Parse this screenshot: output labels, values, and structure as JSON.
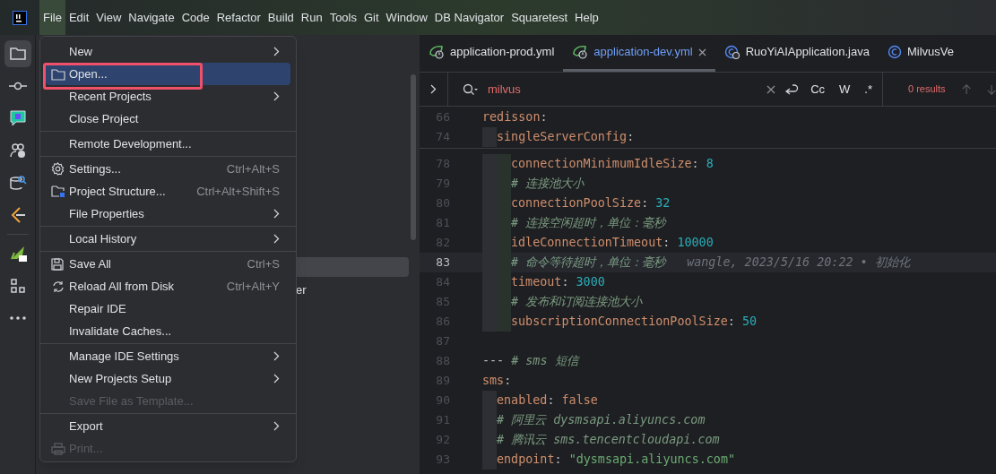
{
  "menubar": {
    "items": [
      {
        "label": "File",
        "selected": true
      },
      {
        "label": "Edit",
        "selected": false
      },
      {
        "label": "View",
        "selected": false
      },
      {
        "label": "Navigate",
        "selected": false
      },
      {
        "label": "Code",
        "selected": false
      },
      {
        "label": "Refactor",
        "selected": false
      },
      {
        "label": "Build",
        "selected": false
      },
      {
        "label": "Run",
        "selected": false
      },
      {
        "label": "Tools",
        "selected": false
      },
      {
        "label": "Git",
        "selected": false
      },
      {
        "label": "Window",
        "selected": false
      },
      {
        "label": "DB Navigator",
        "selected": false
      },
      {
        "label": "Squaretest",
        "selected": false
      },
      {
        "label": "Help",
        "selected": false
      }
    ]
  },
  "toolbar": {
    "items": [
      {
        "kind": "folder",
        "selected": true
      },
      {
        "kind": "commit",
        "selected": false
      },
      {
        "kind": "chat",
        "selected": false
      },
      {
        "kind": "people",
        "selected": false
      },
      {
        "kind": "database",
        "selected": false
      },
      {
        "kind": "code",
        "selected": false
      },
      {
        "kind": "rocket",
        "selected": false
      },
      {
        "kind": "grid",
        "selected": false
      },
      {
        "kind": "more",
        "selected": false
      }
    ]
  },
  "project_panel": {
    "row_text": "er"
  },
  "file_menu": {
    "sections": [
      {
        "items": [
          {
            "label": "New",
            "kind": "plain",
            "submenu": true,
            "selected": false,
            "disabled": false
          },
          {
            "label": "Open...",
            "kind": "folder",
            "submenu": false,
            "selected": true,
            "disabled": false
          },
          {
            "label": "Recent Projects",
            "kind": "plain",
            "submenu": true,
            "selected": false,
            "disabled": false
          },
          {
            "label": "Close Project",
            "kind": "plain",
            "submenu": false,
            "selected": false,
            "disabled": false
          }
        ]
      },
      {
        "items": [
          {
            "label": "Remote Development...",
            "kind": "plain",
            "submenu": false,
            "selected": false,
            "disabled": false
          }
        ]
      },
      {
        "items": [
          {
            "label": "Settings...",
            "kind": "gear",
            "shortcut": "Ctrl+Alt+S",
            "submenu": false,
            "selected": false,
            "disabled": false
          },
          {
            "label": "Project Structure...",
            "kind": "structure",
            "shortcut": "Ctrl+Alt+Shift+S",
            "submenu": false,
            "selected": false,
            "disabled": false
          },
          {
            "label": "File Properties",
            "kind": "plain",
            "submenu": true,
            "selected": false,
            "disabled": false
          }
        ]
      },
      {
        "items": [
          {
            "label": "Local History",
            "kind": "plain",
            "submenu": true,
            "selected": false,
            "disabled": false
          }
        ]
      },
      {
        "items": [
          {
            "label": "Save All",
            "kind": "save",
            "shortcut": "Ctrl+S",
            "submenu": false,
            "selected": false,
            "disabled": false
          },
          {
            "label": "Reload All from Disk",
            "kind": "reload",
            "shortcut": "Ctrl+Alt+Y",
            "submenu": false,
            "selected": false,
            "disabled": false
          },
          {
            "label": "Repair IDE",
            "kind": "plain",
            "submenu": false,
            "selected": false,
            "disabled": false
          },
          {
            "label": "Invalidate Caches...",
            "kind": "plain",
            "submenu": false,
            "selected": false,
            "disabled": false
          }
        ]
      },
      {
        "items": [
          {
            "label": "Manage IDE Settings",
            "kind": "plain",
            "submenu": true,
            "selected": false,
            "disabled": false
          },
          {
            "label": "New Projects Setup",
            "kind": "plain",
            "submenu": true,
            "selected": false,
            "disabled": false
          },
          {
            "label": "Save File as Template...",
            "kind": "plain",
            "submenu": false,
            "selected": false,
            "disabled": true
          }
        ]
      },
      {
        "items": [
          {
            "label": "Export",
            "kind": "plain",
            "submenu": true,
            "selected": false,
            "disabled": false
          },
          {
            "label": "Print...",
            "kind": "print",
            "submenu": false,
            "selected": false,
            "disabled": true
          }
        ]
      }
    ]
  },
  "editor_tabs": [
    {
      "label": "application-prod.yml",
      "kind": "yaml",
      "selected": false
    },
    {
      "label": "application-dev.yml",
      "kind": "yaml",
      "selected": true
    },
    {
      "label": "RuoYiAIApplication.java",
      "kind": "app",
      "selected": false
    },
    {
      "label": "MilvusVe",
      "kind": "class",
      "selected": false
    }
  ],
  "search_bar": {
    "value": "milvus",
    "options": [
      "Cc",
      "W",
      ".*"
    ],
    "results": "0 results"
  },
  "sticky_lines": [
    {
      "number": "66",
      "current": false,
      "tokens": [
        {
          "kind": "key",
          "text": "redisson"
        },
        {
          "kind": "punct",
          "text": ":"
        }
      ],
      "children": [
        {
          "number": "74",
          "current": false,
          "tokens": [
            {
              "kind": "key",
              "text": "singleServerConfig"
            },
            {
              "kind": "punct",
              "text": ":"
            }
          ]
        }
      ]
    }
  ],
  "code_lines": [
    {
      "children": [
        {
          "children": [
            {
              "number": "78",
              "current": false,
              "tokens": [
                {
                  "kind": "key",
                  "text": "connectionMinimumIdleSize"
                },
                {
                  "kind": "punct",
                  "text": ": "
                },
                {
                  "kind": "number",
                  "text": "8"
                }
              ]
            },
            {
              "number": "79",
              "current": false,
              "tokens": [
                {
                  "kind": "comment",
                  "text": "# 连接池大小"
                }
              ]
            },
            {
              "number": "80",
              "current": false,
              "tokens": [
                {
                  "kind": "key",
                  "text": "connectionPoolSize"
                },
                {
                  "kind": "punct",
                  "text": ": "
                },
                {
                  "kind": "number",
                  "text": "32"
                }
              ]
            },
            {
              "number": "81",
              "current": false,
              "tokens": [
                {
                  "kind": "comment",
                  "text": "# 连接空闲超时，单位：毫秒"
                }
              ]
            },
            {
              "number": "82",
              "current": false,
              "tokens": [
                {
                  "kind": "key",
                  "text": "idleConnectionTimeout"
                },
                {
                  "kind": "punct",
                  "text": ": "
                },
                {
                  "kind": "number",
                  "text": "10000"
                }
              ]
            },
            {
              "number": "83",
              "current": true,
              "tokens": [
                {
                  "kind": "comment",
                  "text": "# 命令等待超时，单位：毫秒"
                },
                {
                  "kind": "blame",
                  "text": "wangle, 2023/5/16 20:22 • 初始化"
                }
              ]
            },
            {
              "number": "84",
              "current": false,
              "tokens": [
                {
                  "kind": "key",
                  "text": "timeout"
                },
                {
                  "kind": "punct",
                  "text": ": "
                },
                {
                  "kind": "number",
                  "text": "3000"
                }
              ]
            },
            {
              "number": "85",
              "current": false,
              "tokens": [
                {
                  "kind": "comment",
                  "text": "# 发布和订阅连接池大小"
                }
              ]
            },
            {
              "number": "86",
              "current": false,
              "tokens": [
                {
                  "kind": "key",
                  "text": "subscriptionConnectionPoolSize"
                },
                {
                  "kind": "punct",
                  "text": ": "
                },
                {
                  "kind": "number",
                  "text": "50"
                }
              ]
            }
          ]
        }
      ]
    },
    {
      "number": "87",
      "current": false
    },
    {
      "number": "88",
      "current": false,
      "tokens": [
        {
          "kind": "punct",
          "text": "---"
        },
        {
          "kind": "comment",
          "text": "# sms 短信"
        }
      ]
    },
    {
      "number": "89",
      "current": false,
      "tokens": [
        {
          "kind": "key",
          "text": "sms"
        },
        {
          "kind": "punct",
          "text": ":"
        }
      ],
      "children": [
        {
          "number": "90",
          "current": false,
          "tokens": [
            {
              "kind": "key",
              "text": "enabled"
            },
            {
              "kind": "punct",
              "text": ": "
            },
            {
              "kind": "key",
              "text": "false"
            }
          ]
        },
        {
          "number": "91",
          "current": false,
          "tokens": [
            {
              "kind": "comment",
              "text": "# 阿里云 dysmsapi.aliyuncs.com"
            }
          ]
        },
        {
          "number": "92",
          "current": false,
          "tokens": [
            {
              "kind": "comment",
              "text": "# 腾讯云 sms.tencentcloudapi.com"
            }
          ]
        },
        {
          "number": "93",
          "current": false,
          "tokens": [
            {
              "kind": "key",
              "text": "endpoint"
            },
            {
              "kind": "punct",
              "text": ": "
            },
            {
              "kind": "string",
              "text": "\"dysmsapi.aliyuncs.com\""
            }
          ]
        }
      ]
    }
  ]
}
